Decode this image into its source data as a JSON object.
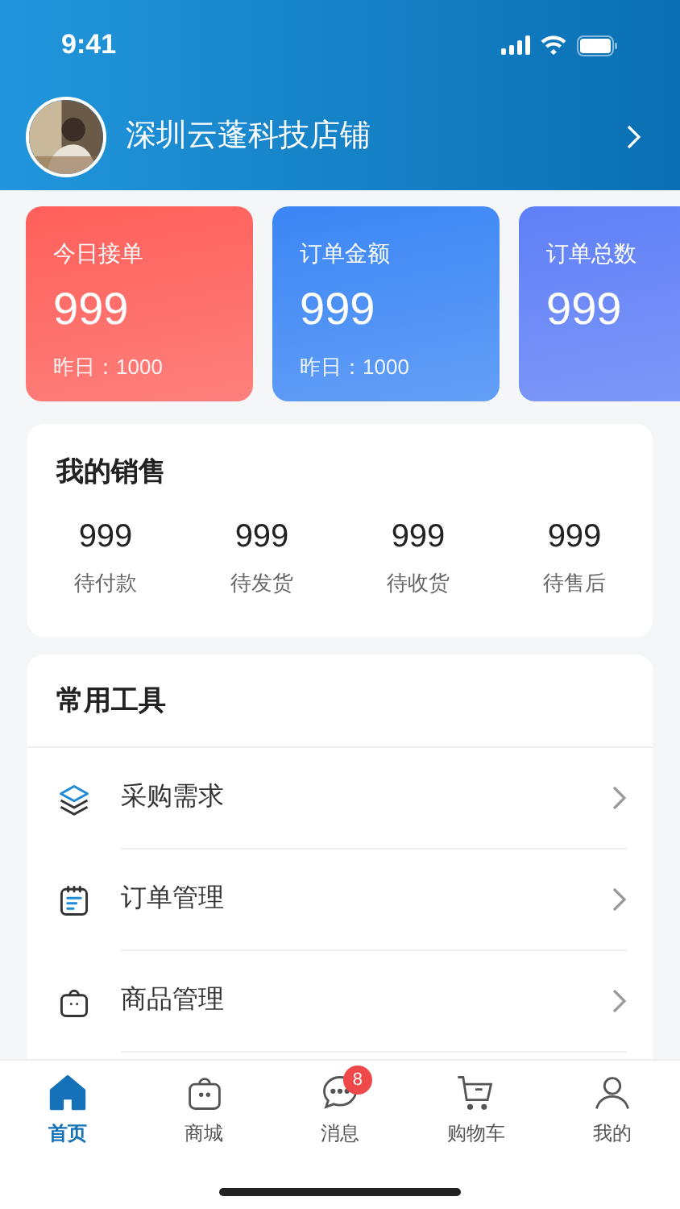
{
  "status_bar": {
    "time": "9:41"
  },
  "store": {
    "name": "深圳云蓬科技店铺"
  },
  "stats": [
    {
      "label": "今日接单",
      "value": "999",
      "yesterday": "昨日：1000",
      "color": "#ff5f5a"
    },
    {
      "label": "订单金额",
      "value": "999",
      "yesterday": "昨日：1000",
      "color": "#3b86f5"
    },
    {
      "label": "订单总数",
      "value": "999",
      "color": "#5f7ff7"
    }
  ],
  "sales": {
    "title": "我的销售",
    "items": [
      {
        "value": "999",
        "label": "待付款"
      },
      {
        "value": "999",
        "label": "待发货"
      },
      {
        "value": "999",
        "label": "待收货"
      },
      {
        "value": "999",
        "label": "待售后"
      }
    ]
  },
  "tools": {
    "title": "常用工具",
    "items": [
      {
        "kind": "layers",
        "label": "采购需求"
      },
      {
        "kind": "calendar",
        "label": "订单管理"
      },
      {
        "kind": "bag",
        "label": "商品管理"
      }
    ]
  },
  "tab_bar": [
    {
      "kind": "home",
      "label": "首页",
      "selected": true
    },
    {
      "kind": "bag",
      "label": "商城",
      "selected": false
    },
    {
      "kind": "chat",
      "label": "消息",
      "selected": false,
      "badge": "8"
    },
    {
      "kind": "cart",
      "label": "购物车",
      "selected": false
    },
    {
      "kind": "user",
      "label": "我的",
      "selected": false
    }
  ]
}
